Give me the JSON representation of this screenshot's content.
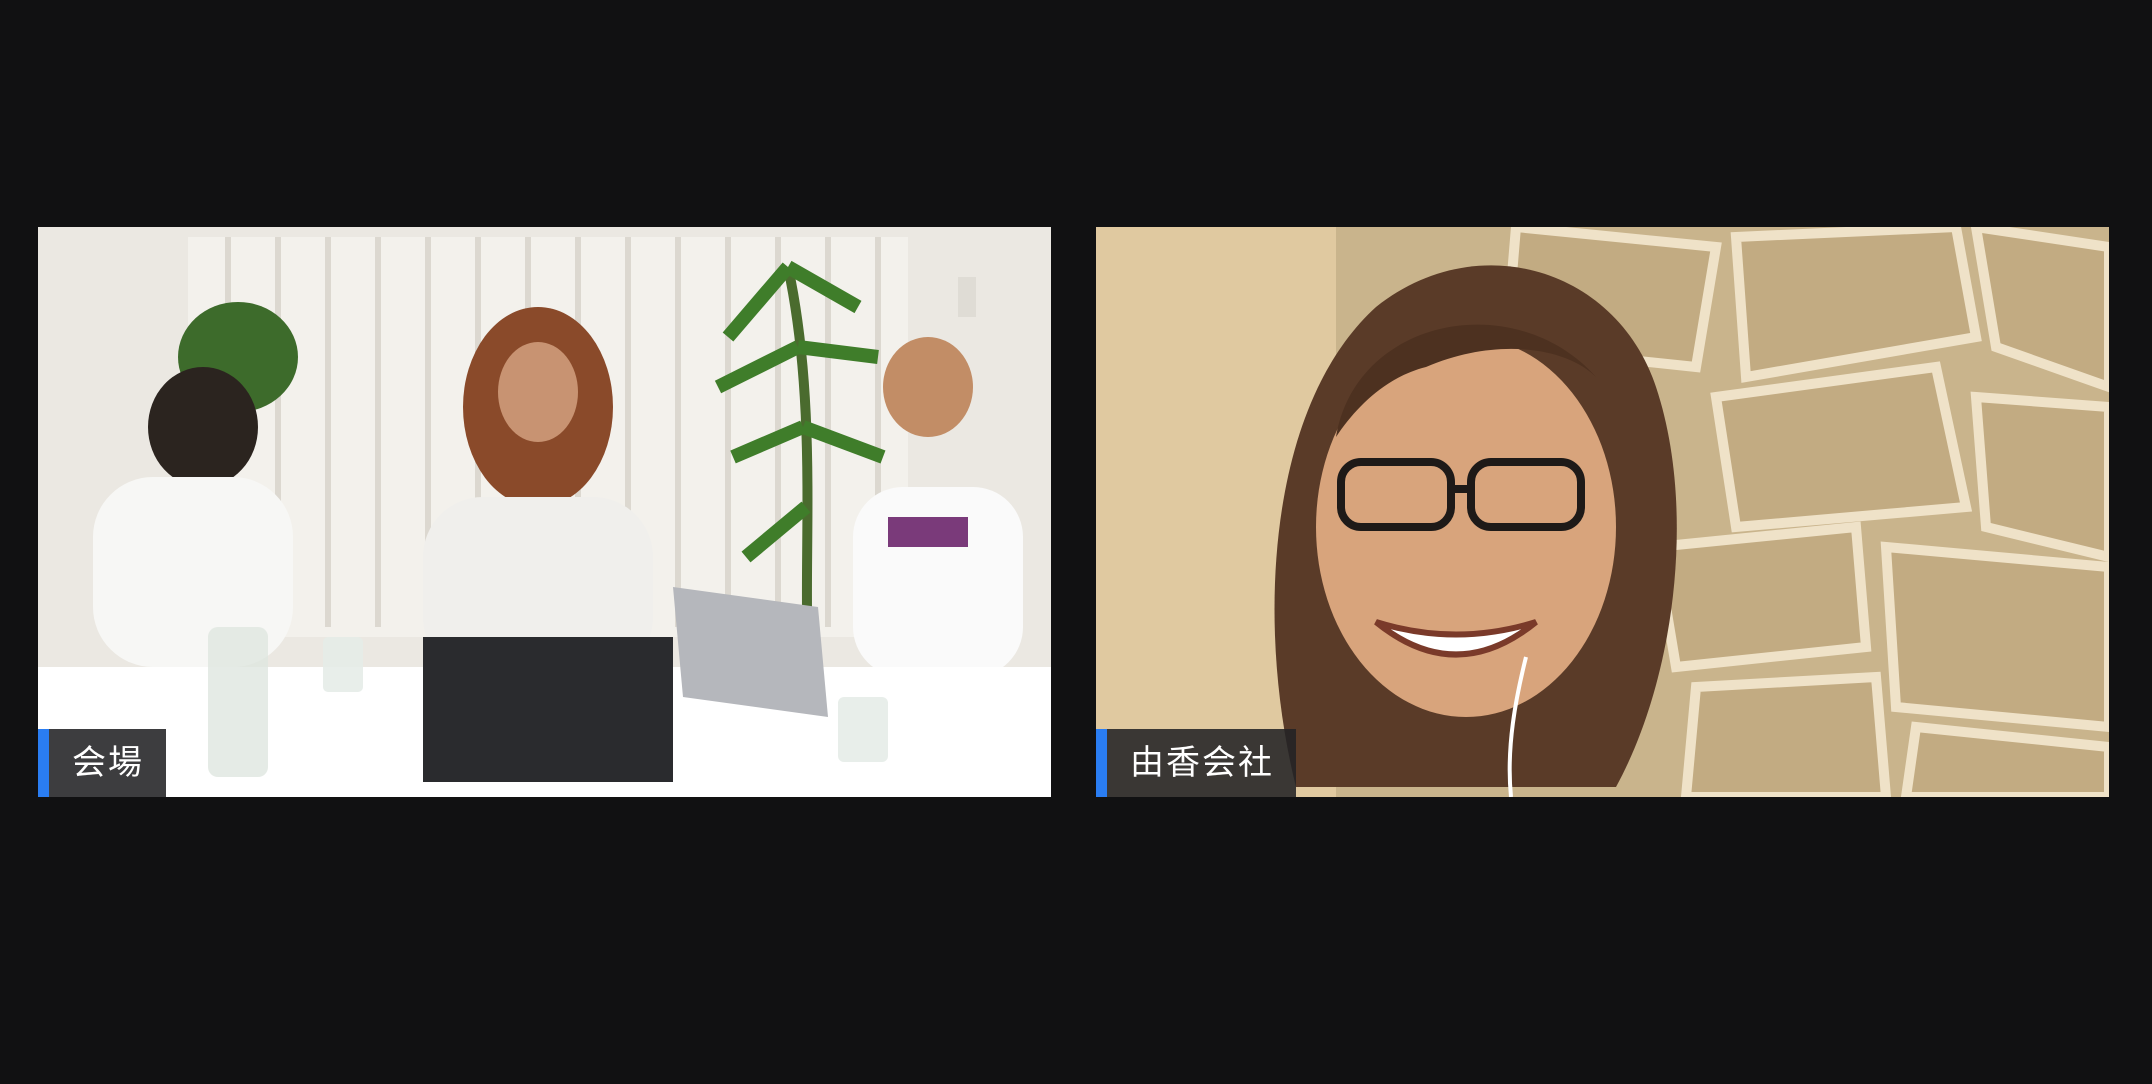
{
  "participants": [
    {
      "name": "会場"
    },
    {
      "name": "由香会社"
    }
  ],
  "colors": {
    "background": "#111112",
    "active_speaker_bar": "#2a7df2"
  }
}
